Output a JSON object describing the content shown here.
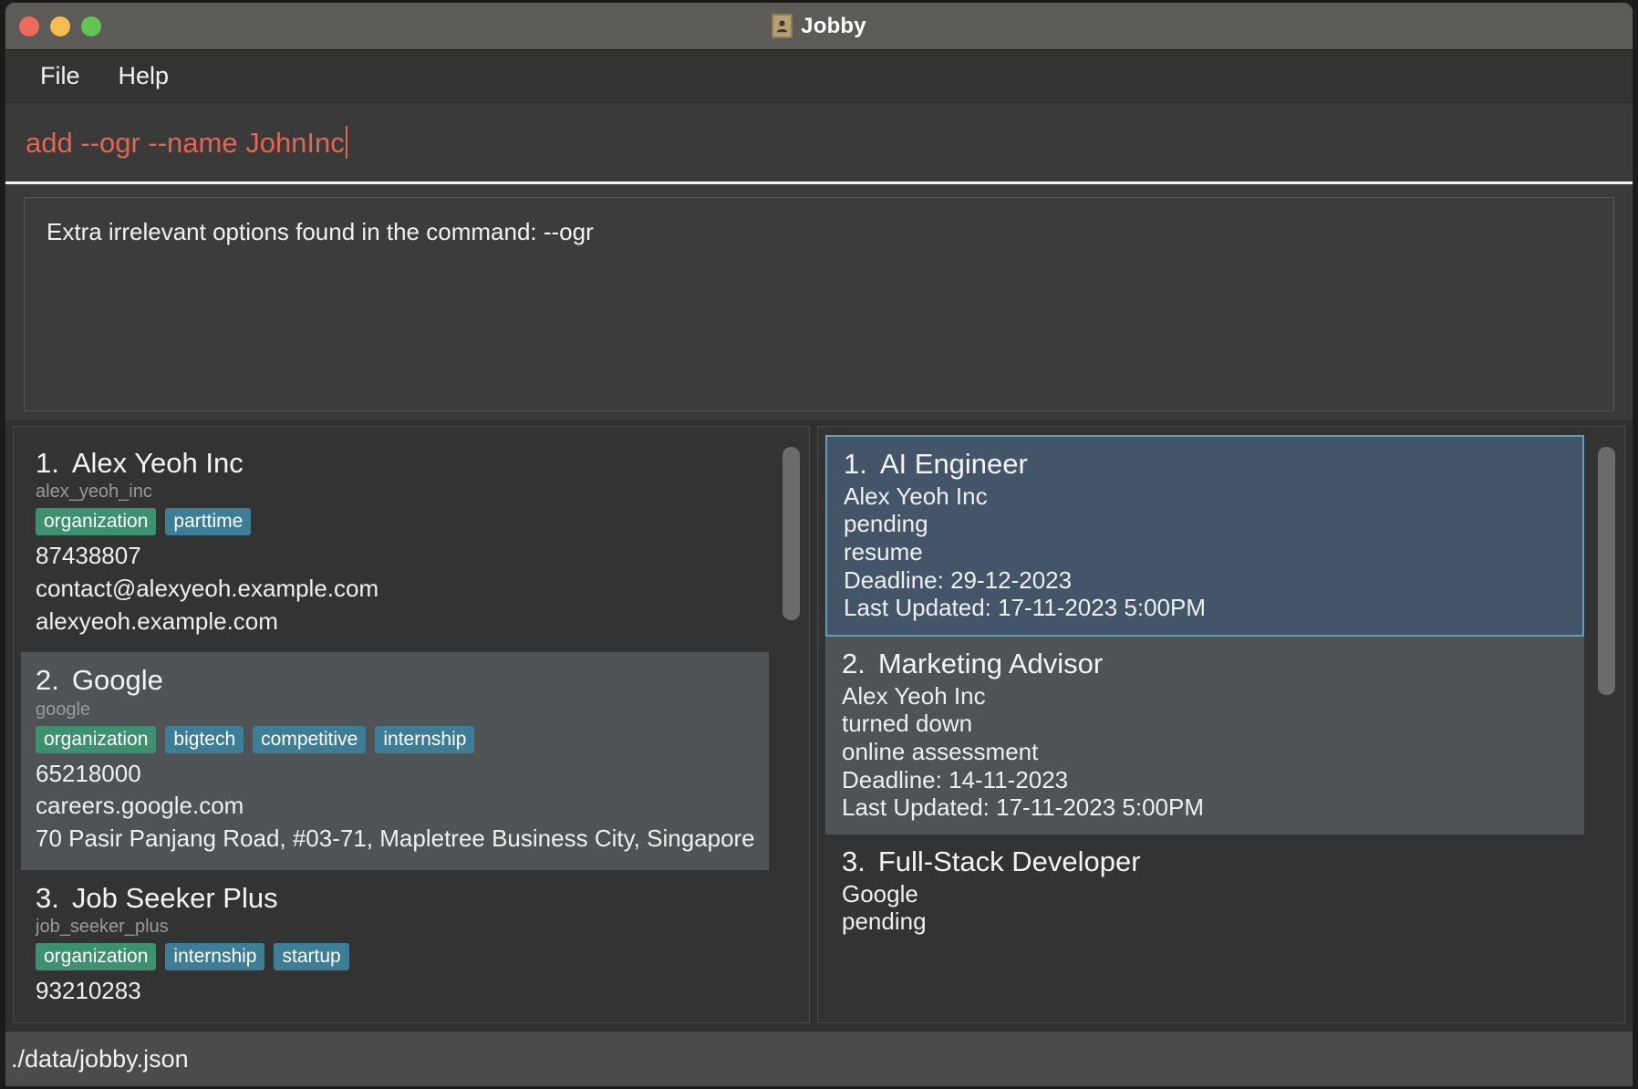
{
  "window": {
    "title": "Jobby",
    "app_icon": "contact-card-icon",
    "traffic_lights": {
      "close_color": "#ed6a5e",
      "minimize_color": "#f4bd4f",
      "maximize_color": "#61c454"
    }
  },
  "menubar": {
    "items": [
      {
        "label": "File"
      },
      {
        "label": "Help"
      }
    ]
  },
  "command": {
    "value": "add --ogr --name JohnInc",
    "text_color": "#e06651"
  },
  "result": {
    "message": "Extra irrelevant options found in the command: --ogr"
  },
  "contacts_panel": {
    "items": [
      {
        "index": "1.",
        "name": "Alex Yeoh Inc",
        "id": "alex_yeoh_inc",
        "tags": [
          {
            "label": "organization",
            "color": "green"
          },
          {
            "label": "parttime",
            "color": "blue"
          }
        ],
        "lines": [
          "87438807",
          "contact@alexyeoh.example.com",
          "alexyeoh.example.com"
        ],
        "highlighted": false
      },
      {
        "index": "2.",
        "name": "Google",
        "id": "google",
        "tags": [
          {
            "label": "organization",
            "color": "green"
          },
          {
            "label": "bigtech",
            "color": "blue"
          },
          {
            "label": "competitive",
            "color": "blue"
          },
          {
            "label": "internship",
            "color": "blue"
          }
        ],
        "lines": [
          "65218000",
          "careers.google.com",
          "70 Pasir Panjang Road, #03-71, Mapletree Business City, Singapore ..."
        ],
        "highlighted": true
      },
      {
        "index": "3.",
        "name": "Job Seeker Plus",
        "id": "job_seeker_plus",
        "tags": [
          {
            "label": "organization",
            "color": "green"
          },
          {
            "label": "internship",
            "color": "blue"
          },
          {
            "label": "startup",
            "color": "blue"
          }
        ],
        "lines": [
          "93210283"
        ],
        "highlighted": false
      }
    ]
  },
  "jobs_panel": {
    "items": [
      {
        "index": "1.",
        "title": "AI Engineer",
        "company": "Alex Yeoh Inc",
        "status": "pending",
        "stage": "resume",
        "deadline": "Deadline: 29-12-2023",
        "last_updated": "Last Updated: 17-11-2023 5:00PM",
        "state": "selected"
      },
      {
        "index": "2.",
        "title": "Marketing Advisor",
        "company": "Alex Yeoh Inc",
        "status": "turned down",
        "stage": "online assessment",
        "deadline": "Deadline: 14-11-2023",
        "last_updated": "Last Updated: 17-11-2023 5:00PM",
        "state": "dim"
      },
      {
        "index": "3.",
        "title": "Full-Stack Developer",
        "company": "Google",
        "status": "pending",
        "stage": "",
        "deadline": "",
        "last_updated": "",
        "state": "normal"
      }
    ]
  },
  "statusbar": {
    "path": "./data/jobby.json"
  },
  "colors": {
    "accent_selected": "#44556a",
    "accent_border": "#63a0b8",
    "tag_green": "#3d9070",
    "tag_blue": "#3d7d95",
    "command_red": "#e06651"
  }
}
